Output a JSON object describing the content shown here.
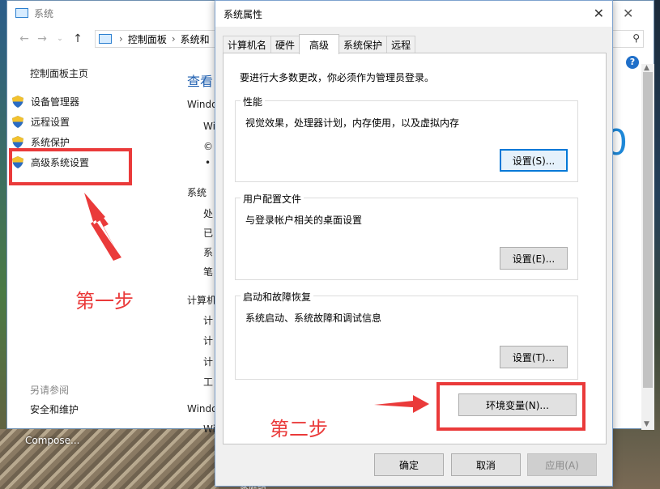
{
  "background_window": {
    "title": "系统",
    "breadcrumb": [
      "控制面板",
      "系统和"
    ],
    "side_home": "控制面板主页",
    "side_items": [
      "设备管理器",
      "远程设置",
      "系统保护",
      "高级系统设置"
    ],
    "see_also": "另请参阅",
    "security": "安全和维护",
    "view_basic": "查看",
    "main_texts": [
      "Windo",
      "Wi",
      "©",
      "•",
      "系统",
      "处",
      "已",
      "系",
      "笔",
      "计算机",
      "计",
      "计",
      "计",
      "工",
      "Windo",
      "Wi"
    ],
    "big_text": "0"
  },
  "desktop": {
    "compose_label": "Compose...",
    "bottom_label": "家庭组"
  },
  "dialog": {
    "title": "系统属性",
    "close": "✕",
    "tabs": [
      "计算机名",
      "硬件",
      "高级",
      "系统保护",
      "远程"
    ],
    "active_tab": "高级",
    "notice": "要进行大多数更改，你必须作为管理员登录。",
    "performance": {
      "title": "性能",
      "desc": "视觉效果，处理器计划，内存使用，以及虚拟内存",
      "button": "设置(S)..."
    },
    "profiles": {
      "title": "用户配置文件",
      "desc": "与登录帐户相关的桌面设置",
      "button": "设置(E)..."
    },
    "startup": {
      "title": "启动和故障恢复",
      "desc": "系统启动、系统故障和调试信息",
      "button": "设置(T)..."
    },
    "env_button": "环境变量(N)...",
    "ok": "确定",
    "cancel": "取消",
    "apply": "应用(A)"
  },
  "annotations": {
    "step1": "第一步",
    "step2": "第二步",
    "color": "#ea3a3a"
  }
}
